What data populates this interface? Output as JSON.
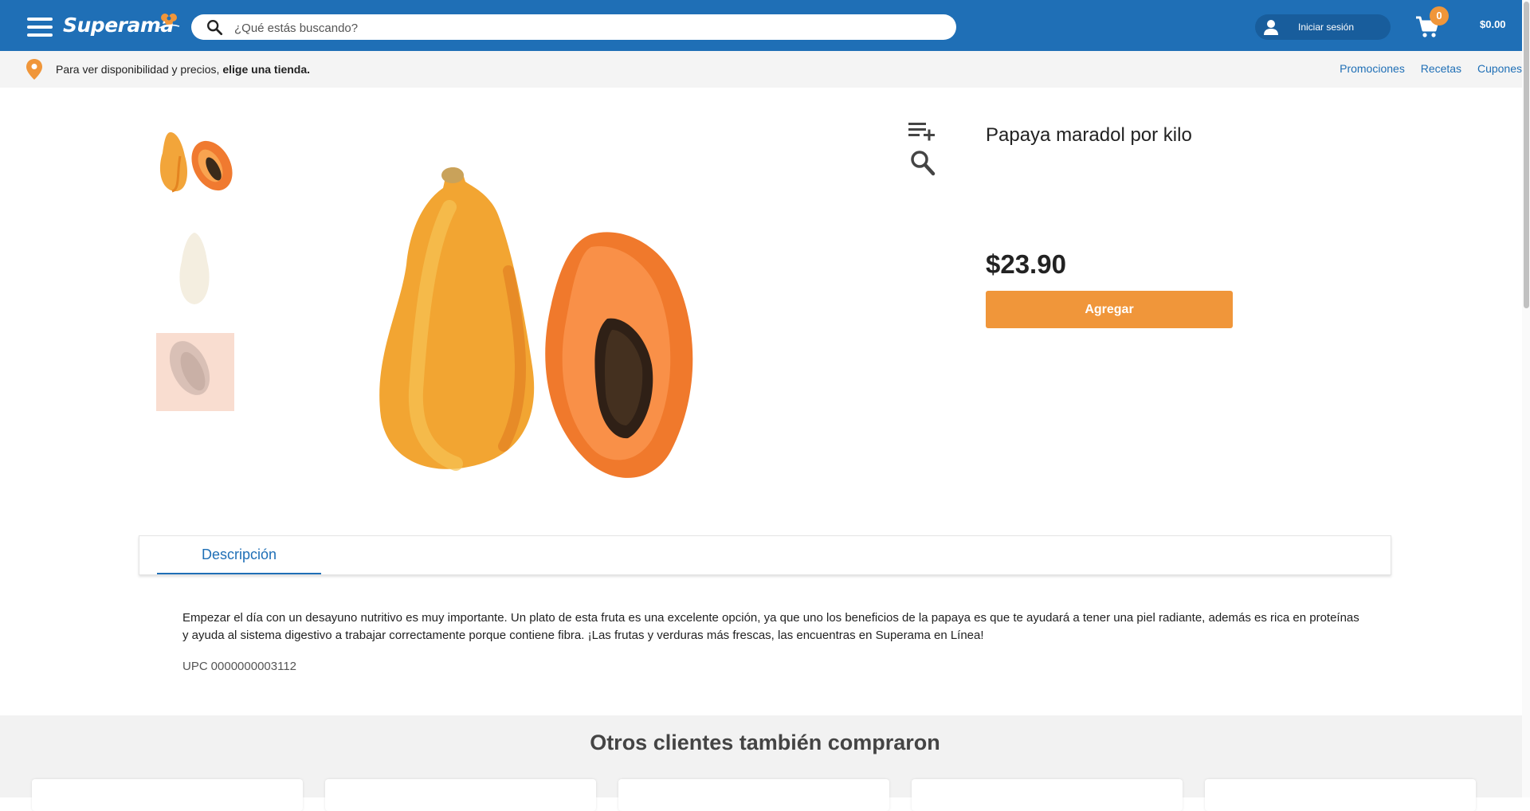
{
  "header": {
    "logo": "Superama",
    "search_placeholder": "¿Qué estás buscando?",
    "login_label": "Iniciar sesión",
    "cart_count": "0",
    "cart_total": "$0.00"
  },
  "store_bar": {
    "message_prefix": "Para ver disponibilidad y precios, ",
    "message_bold": "elige una tienda.",
    "links": [
      "Promociones",
      "Recetas",
      "Cupones"
    ]
  },
  "product": {
    "title": "Papaya maradol por kilo",
    "price": "$23.90",
    "add_label": "Agregar"
  },
  "tabs": {
    "description_label": "Descripción"
  },
  "description": {
    "text": "Empezar el día con un desayuno nutritivo es muy importante. Un plato de esta fruta es una excelente opción, ya que uno los beneficios de la papaya es que te ayudará a tener una piel radiante, además es rica en proteínas y ayuda al sistema digestivo a trabajar correctamente porque contiene fibra. ¡Las frutas y verduras más frescas, las encuentras en Superama en Línea!",
    "upc_label": "UPC",
    "upc_value": "0000000003112"
  },
  "recommendations": {
    "title": "Otros clientes también compraron"
  },
  "colors": {
    "brand_blue": "#1f6fb6",
    "accent_orange": "#f0963a"
  },
  "icons": [
    "menu-icon",
    "flower-logo-icon",
    "search-icon",
    "user-icon",
    "cart-icon",
    "location-pin-icon",
    "playlist-add-icon",
    "zoom-icon"
  ]
}
